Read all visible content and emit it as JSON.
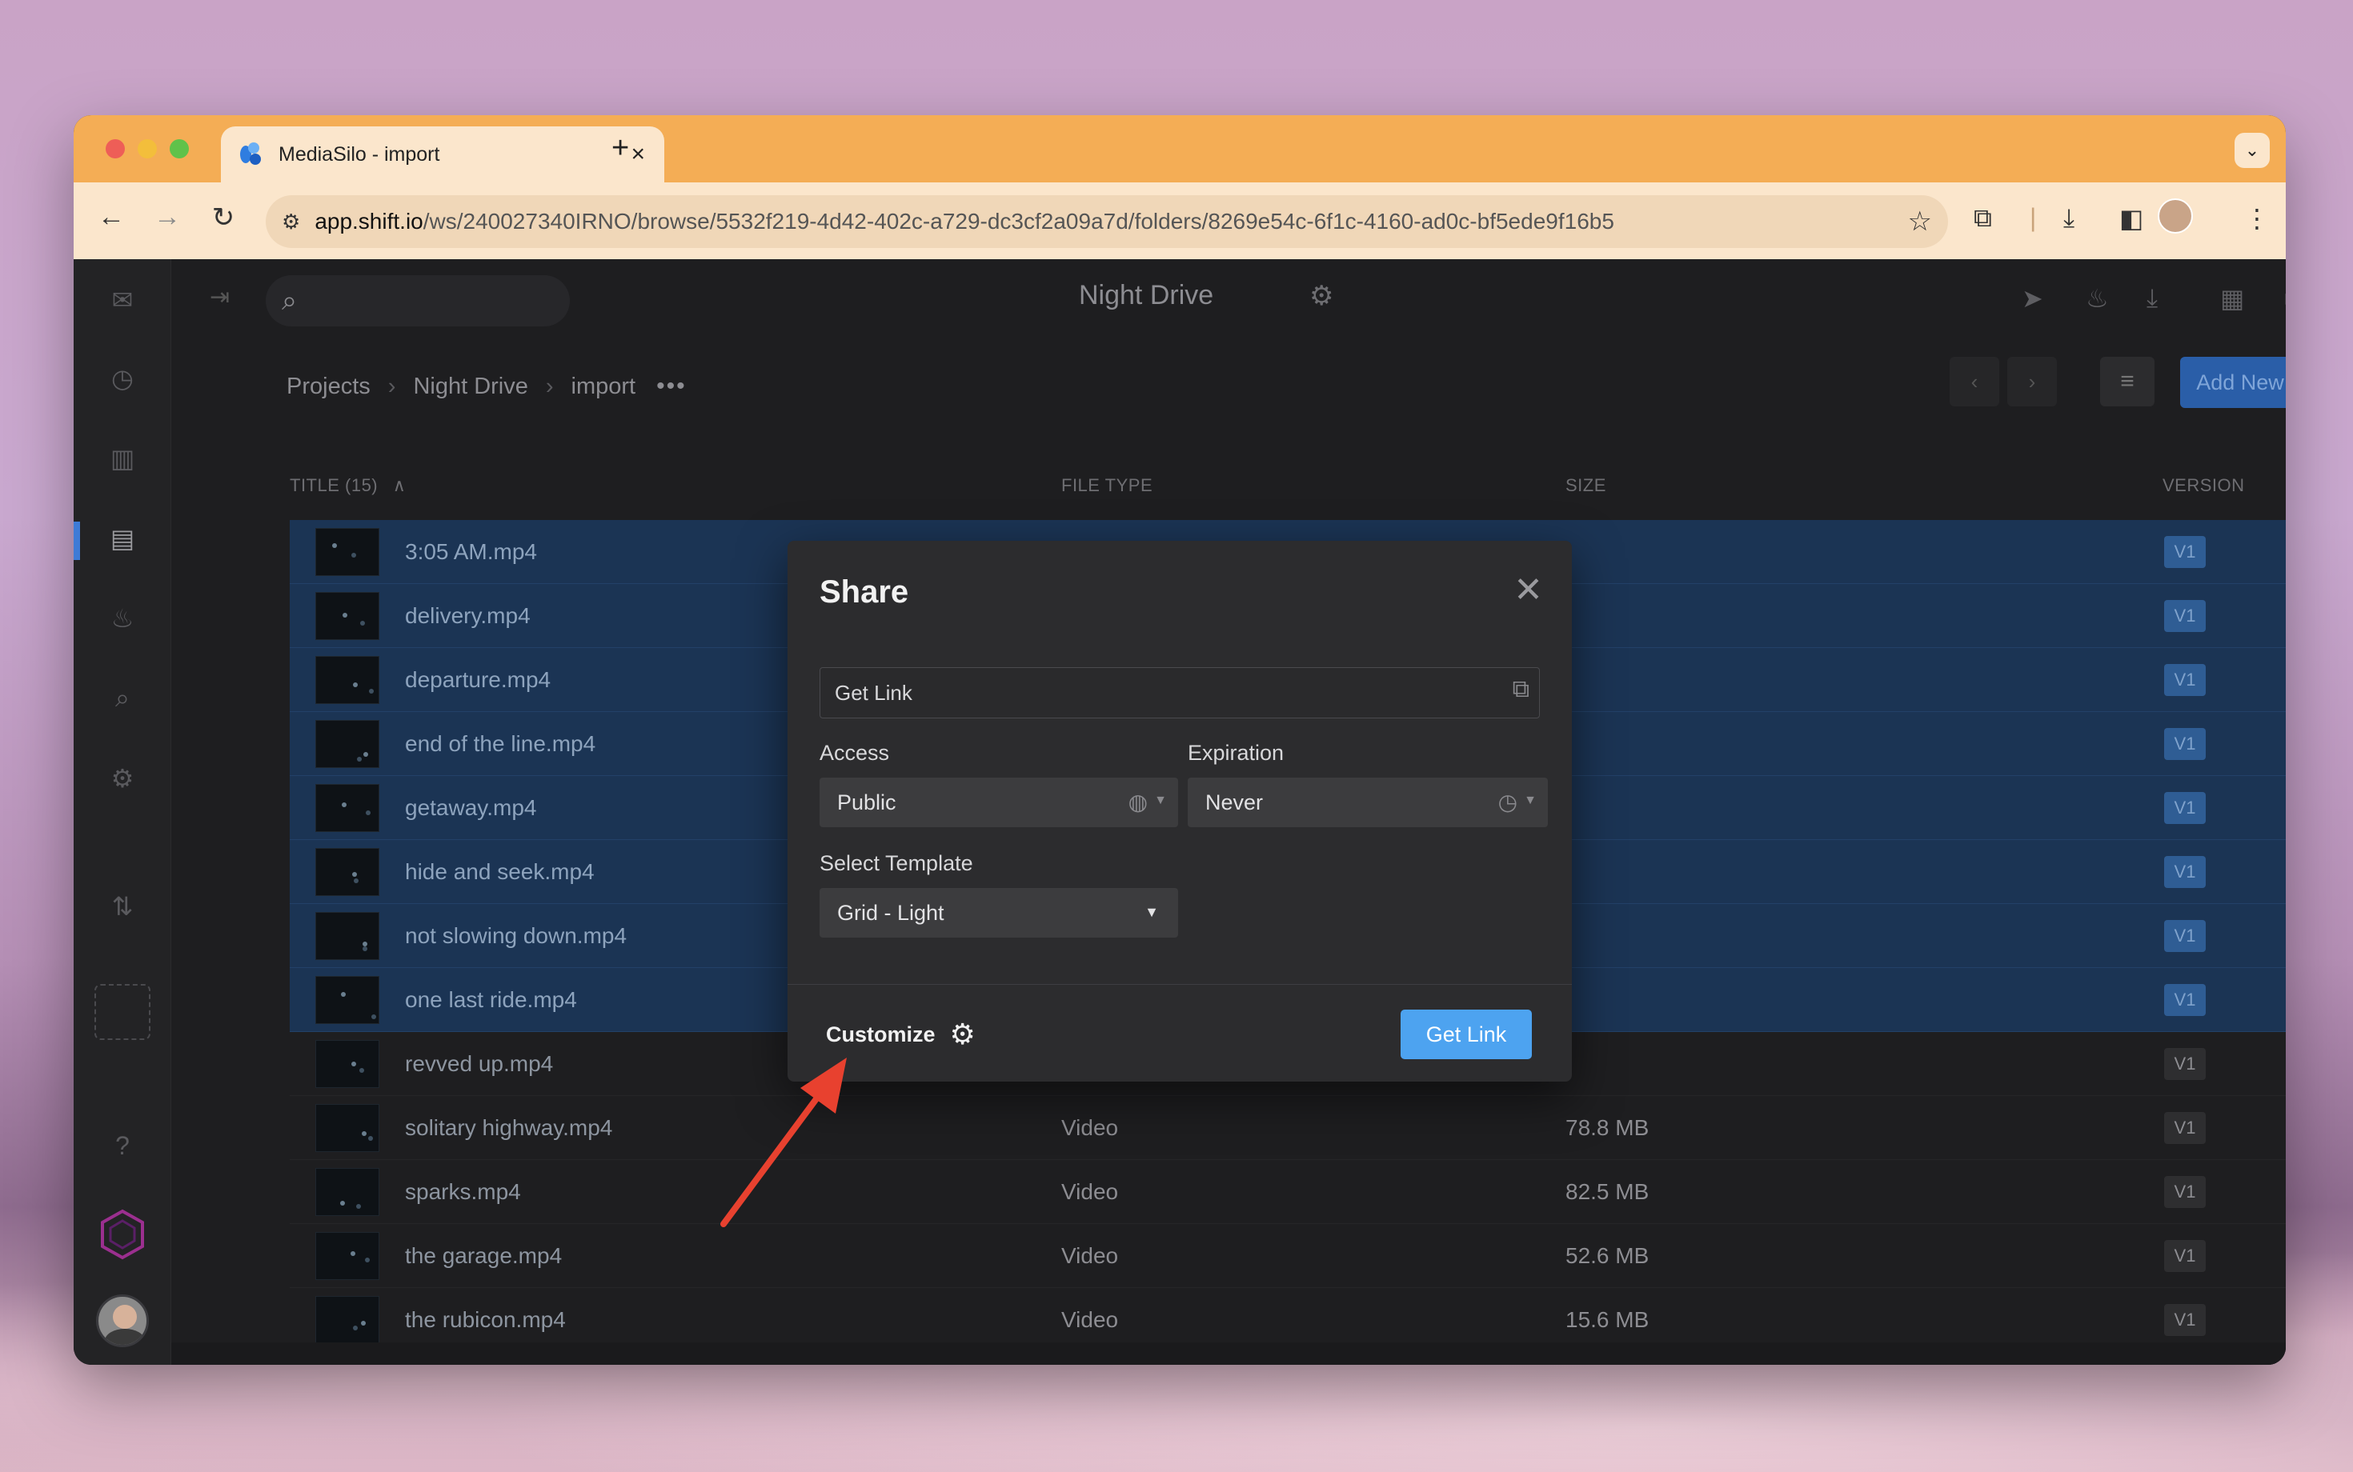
{
  "browser": {
    "tab_title": "MediaSilo - import",
    "url_host": "app.shift.io",
    "url_path": "/ws/240027340IRNO/browse/5532f219-4d42-402c-a729-dc3cf2a09a7d/folders/8269e54c-6f1c-4160-ad0c-bf5ede9f16b5"
  },
  "app": {
    "project_title": "Night Drive",
    "breadcrumb": [
      "Projects",
      "Night Drive",
      "import"
    ],
    "add_new_label": "Add New",
    "columns": {
      "title": "TITLE (15)",
      "file_type": "FILE TYPE",
      "size": "SIZE",
      "version": "VERSION"
    },
    "files": [
      {
        "name": "3:05 AM.mp4",
        "type": "",
        "size": "",
        "version": "V1",
        "selected": true
      },
      {
        "name": "delivery.mp4",
        "type": "",
        "size": "",
        "version": "V1",
        "selected": true
      },
      {
        "name": "departure.mp4",
        "type": "",
        "size": "",
        "version": "V1",
        "selected": true
      },
      {
        "name": "end of the line.mp4",
        "type": "",
        "size": "",
        "version": "V1",
        "selected": true
      },
      {
        "name": "getaway.mp4",
        "type": "",
        "size": "",
        "version": "V1",
        "selected": true
      },
      {
        "name": "hide and seek.mp4",
        "type": "",
        "size": "",
        "version": "V1",
        "selected": true
      },
      {
        "name": "not slowing down.mp4",
        "type": "",
        "size": "",
        "version": "V1",
        "selected": true
      },
      {
        "name": "one last ride.mp4",
        "type": "",
        "size": "",
        "version": "V1",
        "selected": true
      },
      {
        "name": "revved up.mp4",
        "type": "",
        "size": "",
        "version": "V1",
        "selected": false
      },
      {
        "name": "solitary highway.mp4",
        "type": "Video",
        "size": "78.8 MB",
        "version": "V1",
        "selected": false
      },
      {
        "name": "sparks.mp4",
        "type": "Video",
        "size": "82.5 MB",
        "version": "V1",
        "selected": false
      },
      {
        "name": "the garage.mp4",
        "type": "Video",
        "size": "52.6 MB",
        "version": "V1",
        "selected": false
      },
      {
        "name": "the rubicon.mp4",
        "type": "Video",
        "size": "15.6 MB",
        "version": "V1",
        "selected": false
      }
    ]
  },
  "modal": {
    "title": "Share",
    "link_field": "Get Link",
    "access_label": "Access",
    "access_value": "Public",
    "expiration_label": "Expiration",
    "expiration_value": "Never",
    "template_label": "Select Template",
    "template_value": "Grid - Light",
    "customize_label": "Customize",
    "get_link_button": "Get Link"
  },
  "colors": {
    "accent": "#4da3f0",
    "selection": "#1b3454",
    "annotation_arrow": "#e8412f",
    "tab_strip": "#f4ad55"
  }
}
